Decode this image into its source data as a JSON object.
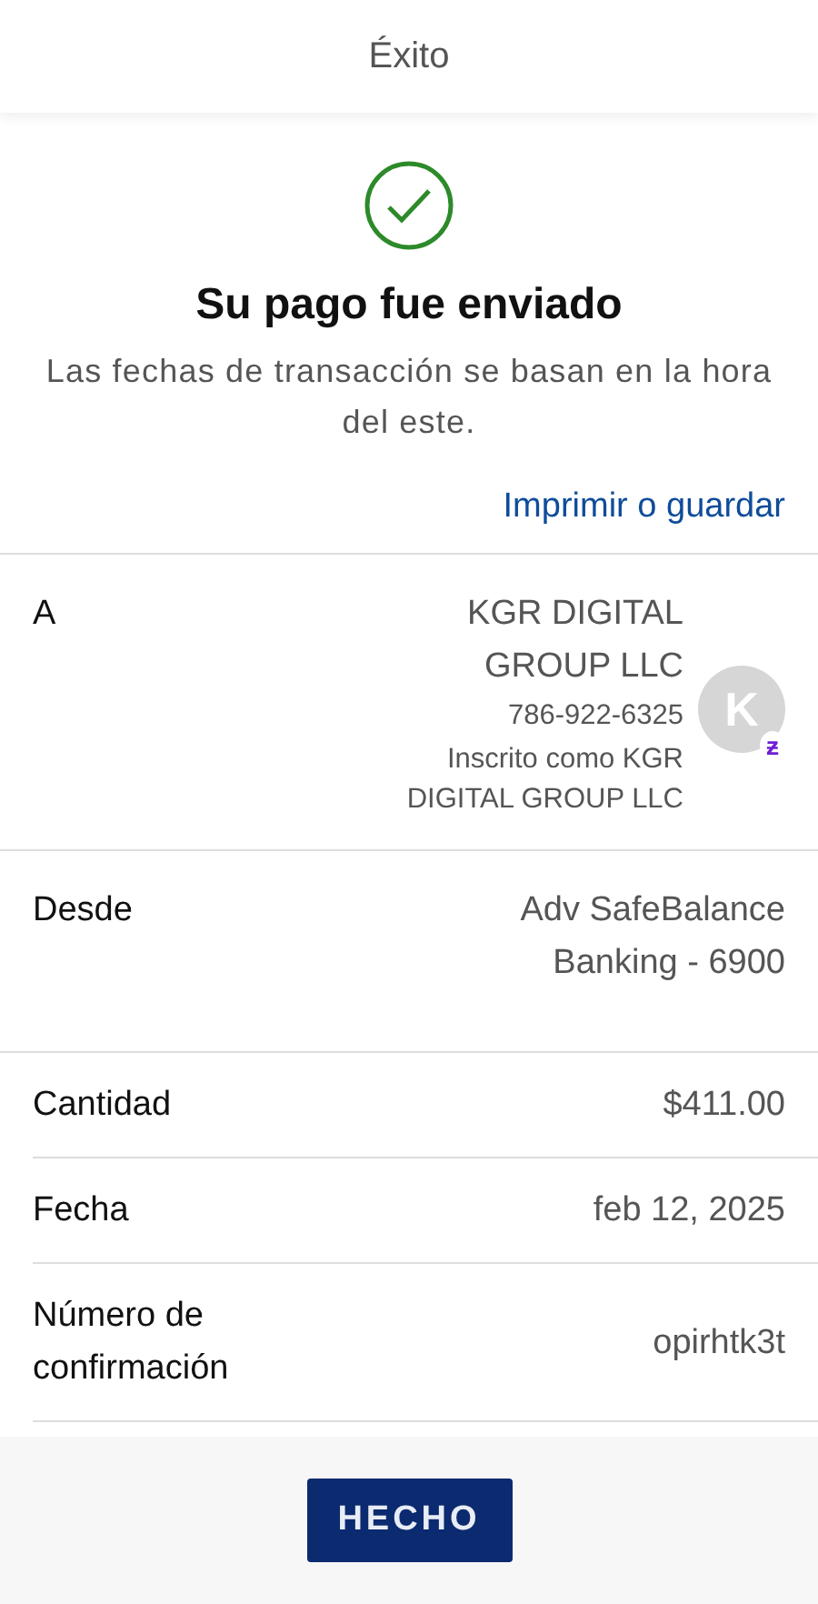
{
  "header": {
    "title": "Éxito"
  },
  "status": {
    "heading": "Su pago fue enviado",
    "note": "Las fechas de transacción se basan en la hora del este.",
    "link": "Imprimir o guardar"
  },
  "details": [
    {
      "label": "A",
      "value": "KGR DIGITAL GROUP LLC",
      "extra": [
        "786-922-6325",
        "Inscrito como KGR DIGITAL GROUP LLC"
      ],
      "avatar": {
        "initial": "K",
        "badge": "ƶ"
      }
    },
    {
      "label": "Desde",
      "value": "Adv SafeBalance Banking - 6900"
    },
    {
      "label": "Cantidad",
      "value": "$411.00"
    },
    {
      "label": "Fecha",
      "value": "feb 12, 2025"
    },
    {
      "label": "Número de confirmación",
      "value": "opirhtk3t"
    }
  ],
  "footer": {
    "button": "HECHO"
  }
}
